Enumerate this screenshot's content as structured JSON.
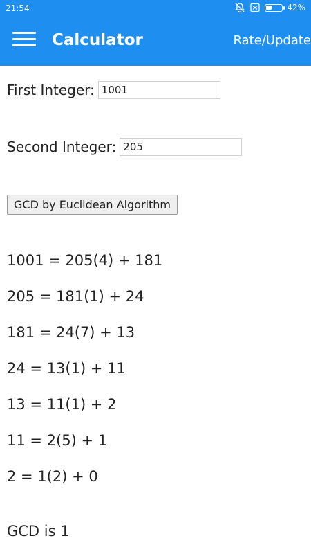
{
  "status_bar": {
    "time": "21:54",
    "battery_percent_label": "42%",
    "battery_level": 0.42,
    "icons": [
      "muted-bell-icon",
      "no-sim-icon",
      "battery-icon"
    ]
  },
  "app_bar": {
    "title": "Calculator",
    "menu_icon": "hamburger-menu-icon",
    "action_label": "Rate/Update",
    "color": "#1f8ef1"
  },
  "form": {
    "first_label": "First Integer:",
    "first_value": "1001",
    "second_label": "Second Integer:",
    "second_value": "205",
    "button_label": "GCD by Euclidean Algorithm"
  },
  "steps": [
    "1001 = 205(4) + 181",
    "205 = 181(1) + 24",
    "181 = 24(7) + 13",
    "24 = 13(1) + 11",
    "13 = 11(1) + 2",
    "11 = 2(5) + 1",
    "2 = 1(2) + 0"
  ],
  "result": "GCD is 1"
}
